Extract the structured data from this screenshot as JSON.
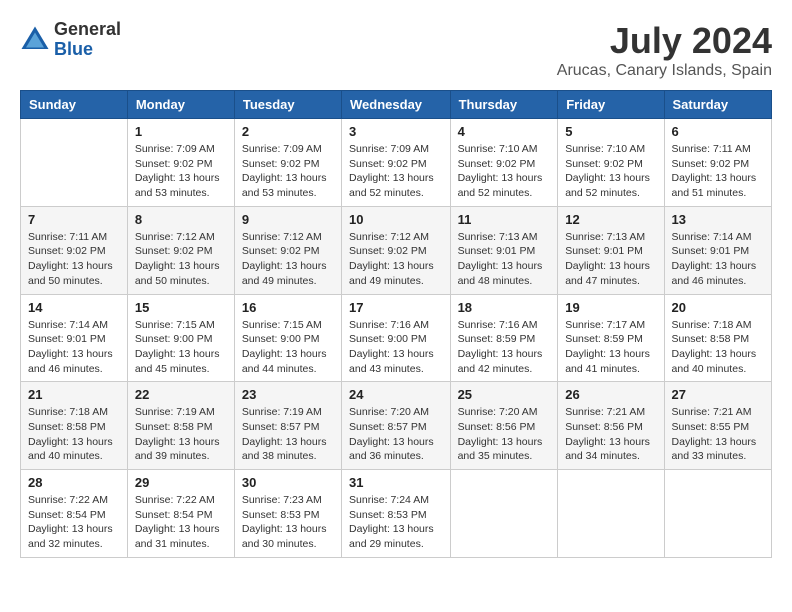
{
  "logo": {
    "general": "General",
    "blue": "Blue"
  },
  "title": "July 2024",
  "location": "Arucas, Canary Islands, Spain",
  "days_of_week": [
    "Sunday",
    "Monday",
    "Tuesday",
    "Wednesday",
    "Thursday",
    "Friday",
    "Saturday"
  ],
  "weeks": [
    [
      {
        "day": "",
        "sunrise": "",
        "sunset": "",
        "daylight": ""
      },
      {
        "day": "1",
        "sunrise": "Sunrise: 7:09 AM",
        "sunset": "Sunset: 9:02 PM",
        "daylight": "Daylight: 13 hours and 53 minutes."
      },
      {
        "day": "2",
        "sunrise": "Sunrise: 7:09 AM",
        "sunset": "Sunset: 9:02 PM",
        "daylight": "Daylight: 13 hours and 53 minutes."
      },
      {
        "day": "3",
        "sunrise": "Sunrise: 7:09 AM",
        "sunset": "Sunset: 9:02 PM",
        "daylight": "Daylight: 13 hours and 52 minutes."
      },
      {
        "day": "4",
        "sunrise": "Sunrise: 7:10 AM",
        "sunset": "Sunset: 9:02 PM",
        "daylight": "Daylight: 13 hours and 52 minutes."
      },
      {
        "day": "5",
        "sunrise": "Sunrise: 7:10 AM",
        "sunset": "Sunset: 9:02 PM",
        "daylight": "Daylight: 13 hours and 52 minutes."
      },
      {
        "day": "6",
        "sunrise": "Sunrise: 7:11 AM",
        "sunset": "Sunset: 9:02 PM",
        "daylight": "Daylight: 13 hours and 51 minutes."
      }
    ],
    [
      {
        "day": "7",
        "sunrise": "Sunrise: 7:11 AM",
        "sunset": "Sunset: 9:02 PM",
        "daylight": "Daylight: 13 hours and 50 minutes."
      },
      {
        "day": "8",
        "sunrise": "Sunrise: 7:12 AM",
        "sunset": "Sunset: 9:02 PM",
        "daylight": "Daylight: 13 hours and 50 minutes."
      },
      {
        "day": "9",
        "sunrise": "Sunrise: 7:12 AM",
        "sunset": "Sunset: 9:02 PM",
        "daylight": "Daylight: 13 hours and 49 minutes."
      },
      {
        "day": "10",
        "sunrise": "Sunrise: 7:12 AM",
        "sunset": "Sunset: 9:02 PM",
        "daylight": "Daylight: 13 hours and 49 minutes."
      },
      {
        "day": "11",
        "sunrise": "Sunrise: 7:13 AM",
        "sunset": "Sunset: 9:01 PM",
        "daylight": "Daylight: 13 hours and 48 minutes."
      },
      {
        "day": "12",
        "sunrise": "Sunrise: 7:13 AM",
        "sunset": "Sunset: 9:01 PM",
        "daylight": "Daylight: 13 hours and 47 minutes."
      },
      {
        "day": "13",
        "sunrise": "Sunrise: 7:14 AM",
        "sunset": "Sunset: 9:01 PM",
        "daylight": "Daylight: 13 hours and 46 minutes."
      }
    ],
    [
      {
        "day": "14",
        "sunrise": "Sunrise: 7:14 AM",
        "sunset": "Sunset: 9:01 PM",
        "daylight": "Daylight: 13 hours and 46 minutes."
      },
      {
        "day": "15",
        "sunrise": "Sunrise: 7:15 AM",
        "sunset": "Sunset: 9:00 PM",
        "daylight": "Daylight: 13 hours and 45 minutes."
      },
      {
        "day": "16",
        "sunrise": "Sunrise: 7:15 AM",
        "sunset": "Sunset: 9:00 PM",
        "daylight": "Daylight: 13 hours and 44 minutes."
      },
      {
        "day": "17",
        "sunrise": "Sunrise: 7:16 AM",
        "sunset": "Sunset: 9:00 PM",
        "daylight": "Daylight: 13 hours and 43 minutes."
      },
      {
        "day": "18",
        "sunrise": "Sunrise: 7:16 AM",
        "sunset": "Sunset: 8:59 PM",
        "daylight": "Daylight: 13 hours and 42 minutes."
      },
      {
        "day": "19",
        "sunrise": "Sunrise: 7:17 AM",
        "sunset": "Sunset: 8:59 PM",
        "daylight": "Daylight: 13 hours and 41 minutes."
      },
      {
        "day": "20",
        "sunrise": "Sunrise: 7:18 AM",
        "sunset": "Sunset: 8:58 PM",
        "daylight": "Daylight: 13 hours and 40 minutes."
      }
    ],
    [
      {
        "day": "21",
        "sunrise": "Sunrise: 7:18 AM",
        "sunset": "Sunset: 8:58 PM",
        "daylight": "Daylight: 13 hours and 40 minutes."
      },
      {
        "day": "22",
        "sunrise": "Sunrise: 7:19 AM",
        "sunset": "Sunset: 8:58 PM",
        "daylight": "Daylight: 13 hours and 39 minutes."
      },
      {
        "day": "23",
        "sunrise": "Sunrise: 7:19 AM",
        "sunset": "Sunset: 8:57 PM",
        "daylight": "Daylight: 13 hours and 38 minutes."
      },
      {
        "day": "24",
        "sunrise": "Sunrise: 7:20 AM",
        "sunset": "Sunset: 8:57 PM",
        "daylight": "Daylight: 13 hours and 36 minutes."
      },
      {
        "day": "25",
        "sunrise": "Sunrise: 7:20 AM",
        "sunset": "Sunset: 8:56 PM",
        "daylight": "Daylight: 13 hours and 35 minutes."
      },
      {
        "day": "26",
        "sunrise": "Sunrise: 7:21 AM",
        "sunset": "Sunset: 8:56 PM",
        "daylight": "Daylight: 13 hours and 34 minutes."
      },
      {
        "day": "27",
        "sunrise": "Sunrise: 7:21 AM",
        "sunset": "Sunset: 8:55 PM",
        "daylight": "Daylight: 13 hours and 33 minutes."
      }
    ],
    [
      {
        "day": "28",
        "sunrise": "Sunrise: 7:22 AM",
        "sunset": "Sunset: 8:54 PM",
        "daylight": "Daylight: 13 hours and 32 minutes."
      },
      {
        "day": "29",
        "sunrise": "Sunrise: 7:22 AM",
        "sunset": "Sunset: 8:54 PM",
        "daylight": "Daylight: 13 hours and 31 minutes."
      },
      {
        "day": "30",
        "sunrise": "Sunrise: 7:23 AM",
        "sunset": "Sunset: 8:53 PM",
        "daylight": "Daylight: 13 hours and 30 minutes."
      },
      {
        "day": "31",
        "sunrise": "Sunrise: 7:24 AM",
        "sunset": "Sunset: 8:53 PM",
        "daylight": "Daylight: 13 hours and 29 minutes."
      },
      {
        "day": "",
        "sunrise": "",
        "sunset": "",
        "daylight": ""
      },
      {
        "day": "",
        "sunrise": "",
        "sunset": "",
        "daylight": ""
      },
      {
        "day": "",
        "sunrise": "",
        "sunset": "",
        "daylight": ""
      }
    ]
  ]
}
